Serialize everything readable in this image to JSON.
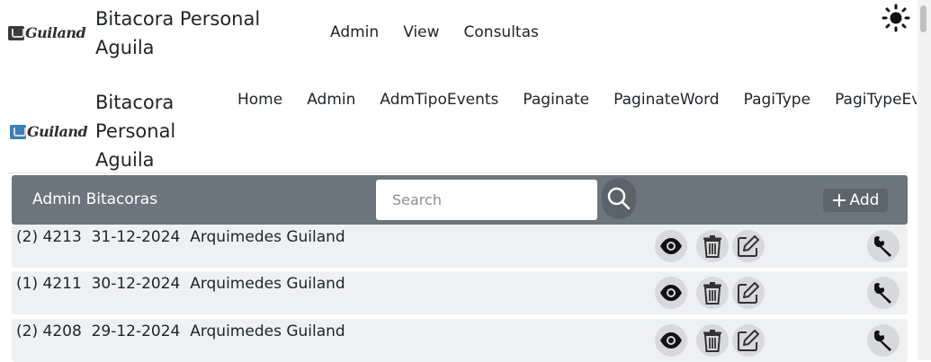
{
  "header": {
    "logo_text": "Guiland",
    "brand_title": "Bitacora Personal Aguila",
    "brand_line1": "Bitacora Personal",
    "brand_line2": "Aguila",
    "nav": [
      "Admin",
      "View",
      "Consultas"
    ],
    "theme_icon": "sun-icon"
  },
  "subnav": {
    "logo_text": "Guiland",
    "brand_line1": "Bitacora",
    "brand_line2": "Personal",
    "brand_line3": "Aguila",
    "items": [
      "Home",
      "Admin",
      "AdmTipoEvents",
      "Paginate",
      "PaginateWord",
      "PagiType",
      "PagiTypeEve"
    ]
  },
  "toolbar": {
    "title": "Admin Bitacoras",
    "search_placeholder": "Search",
    "search_icon": "search-icon",
    "add_label": "Add",
    "add_icon": "plus-icon"
  },
  "records": [
    {
      "count": "(2)",
      "id": "4213",
      "date": "31-12-2024",
      "author": "Arquimedes Guiland"
    },
    {
      "count": "(1)",
      "id": "4211",
      "date": "30-12-2024",
      "author": "Arquimedes Guiland"
    },
    {
      "count": "(2)",
      "id": "4208",
      "date": "29-12-2024",
      "author": "Arquimedes Guiland"
    }
  ],
  "row_actions": [
    "eye-icon",
    "trash-icon",
    "edit-icon",
    "wrench-icon"
  ],
  "colors": {
    "toolbar_bg": "#6c757d",
    "row_bg": "#eff0f2",
    "icon_circle_bg": "#d7d9dc",
    "text": "#212529"
  }
}
